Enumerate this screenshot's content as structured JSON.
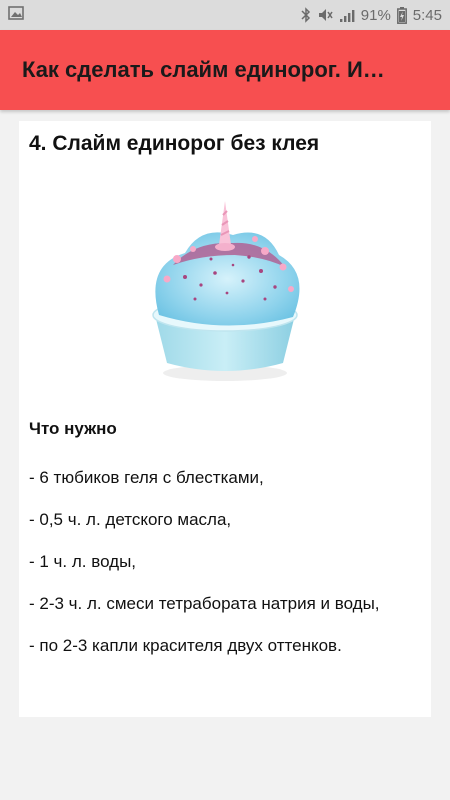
{
  "status_bar": {
    "battery_percent": "91%",
    "time": "5:45",
    "icons": [
      "image-icon",
      "bluetooth-icon",
      "mute-icon",
      "signal-icon",
      "battery-icon"
    ]
  },
  "toolbar": {
    "title": "Как сделать слайм единорог. И…",
    "color": "#f74f50"
  },
  "article": {
    "heading": "4. Слайм единорог без клея",
    "image": "unicorn slime cup",
    "section_title": "Что нужно",
    "items": [
      "- 6 тюбиков геля с блестками,",
      "- 0,5 ч. л. детского масла,",
      "- 1 ч. л. воды,",
      "- 2-3 ч. л. смеси тетрабората натрия и воды,",
      "- по 2-3 капли красителя двух оттенков."
    ]
  }
}
